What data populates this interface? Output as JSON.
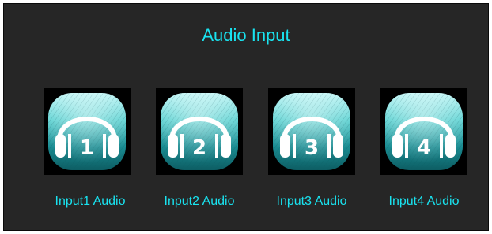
{
  "panel": {
    "title": "Audio Input"
  },
  "colors": {
    "background": "#262626",
    "accent": "#19e3f0",
    "tile_background": "#000000"
  },
  "inputs": [
    {
      "number": "1",
      "label": "Input1 Audio",
      "icon": "headphones-icon"
    },
    {
      "number": "2",
      "label": "Input2 Audio",
      "icon": "headphones-icon"
    },
    {
      "number": "3",
      "label": "Input3 Audio",
      "icon": "headphones-icon"
    },
    {
      "number": "4",
      "label": "Input4 Audio",
      "icon": "headphones-icon"
    }
  ]
}
